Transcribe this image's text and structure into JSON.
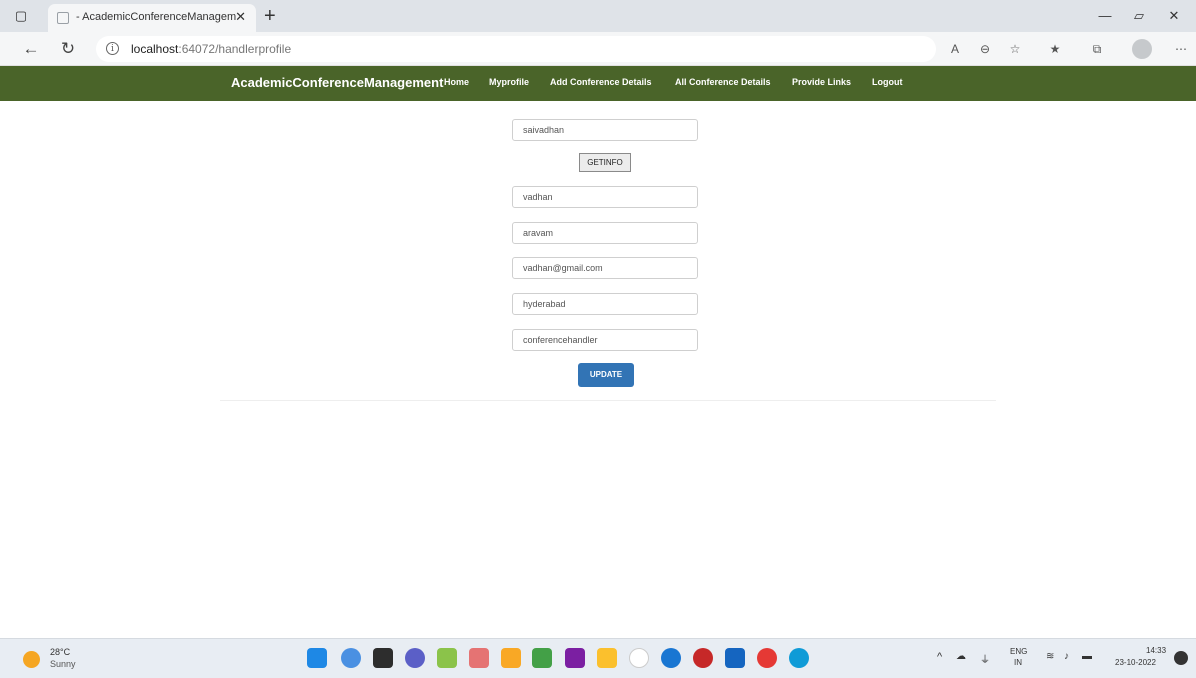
{
  "browser": {
    "tab_title": "- AcademicConferenceManagem",
    "url_host": "localhost",
    "url_path": ":64072/handlerprofile"
  },
  "navbar": {
    "brand": "AcademicConferenceManagement",
    "links": [
      "Home",
      "Myprofile",
      "Add Conference Details",
      "All Conference Details",
      "Provide Links",
      "Logout"
    ]
  },
  "form": {
    "username": "saivadhan",
    "getinfo_label": "GETINFO",
    "first_name": "vadhan",
    "last_name": "aravam",
    "email": "vadhan@gmail.com",
    "city": "hyderabad",
    "role": "conferencehandler",
    "update_label": "UPDATE"
  },
  "taskbar": {
    "temperature": "28°C",
    "weather": "Sunny",
    "language": "ENG",
    "region": "IN",
    "time": "14:33",
    "date": "23-10-2022"
  },
  "colors": {
    "navbar_bg": "#4a6429",
    "update_button": "#3274b5"
  }
}
